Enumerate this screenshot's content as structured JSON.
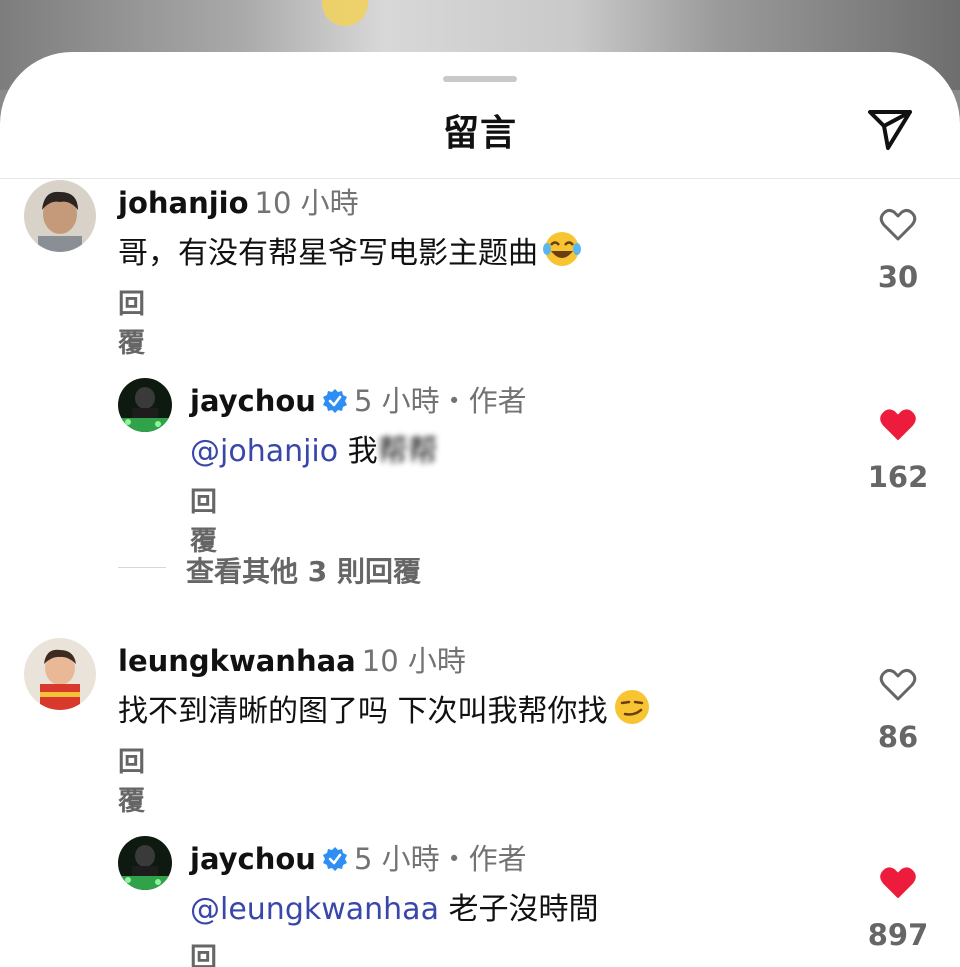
{
  "sheet": {
    "title": "留言"
  },
  "comments": [
    {
      "username": "johanjio",
      "time": "10 小時",
      "text": "哥，有没有帮星爷写电影主题曲",
      "emoji": "laughing-tears",
      "reply_label": "回覆",
      "likes": "30",
      "liked": false
    },
    {
      "username": "jaychou",
      "verified": true,
      "time": "5 小時・作者",
      "mention": "@johanjio",
      "text": "我",
      "text_blurred": "帮帮",
      "reply_label": "回覆",
      "likes": "162",
      "liked": true
    },
    {
      "username": "leungkwanhaa",
      "time": "10 小時",
      "text": "找不到清晰的图了吗 下次叫我帮你找",
      "emoji": "smirk",
      "reply_label": "回覆",
      "likes": "86",
      "liked": false
    },
    {
      "username": "jaychou",
      "verified": true,
      "time": "5 小時・作者",
      "mention": "@leungkwanhaa",
      "text": "老子沒時間",
      "reply_label": "回覆",
      "likes": "897",
      "liked": true
    }
  ],
  "view_more": "查看其他 3 則回覆",
  "colors": {
    "mention": "#3847a8",
    "like_red": "#ed1c3c",
    "verified_blue": "#2f8ef4",
    "muted": "#737373"
  }
}
